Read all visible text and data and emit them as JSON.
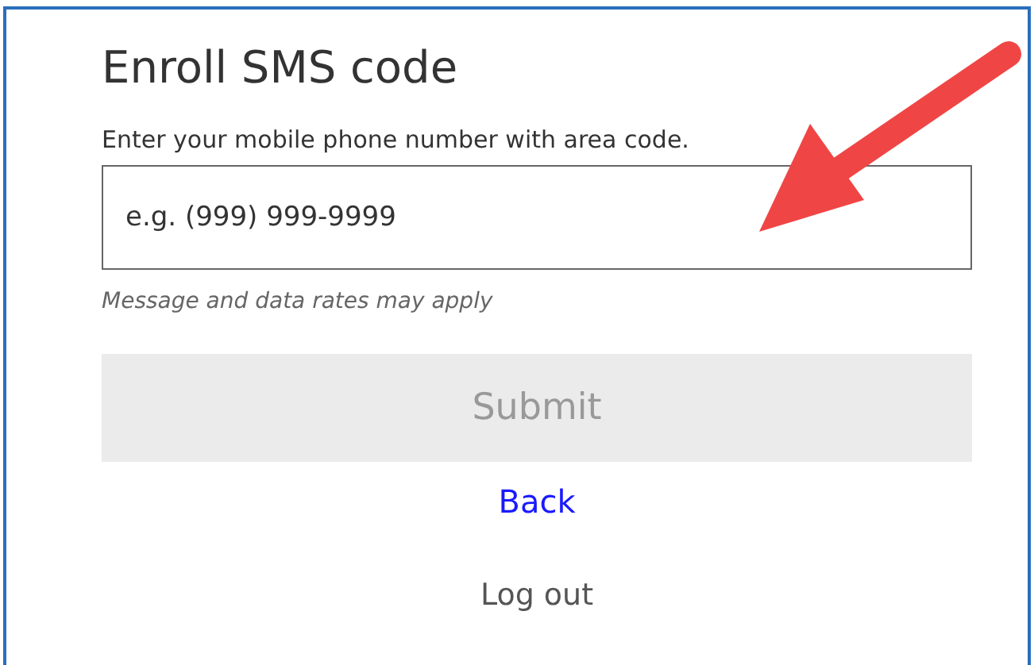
{
  "title": "Enroll SMS code",
  "instruction": "Enter your mobile phone number with area code.",
  "phone_field": {
    "placeholder": "e.g. (999) 999-9999"
  },
  "hint": "Message and data rates may apply",
  "submit_button": {
    "label": "Submit",
    "disabled": true
  },
  "back_link": "Back",
  "logout_link": "Log out"
}
